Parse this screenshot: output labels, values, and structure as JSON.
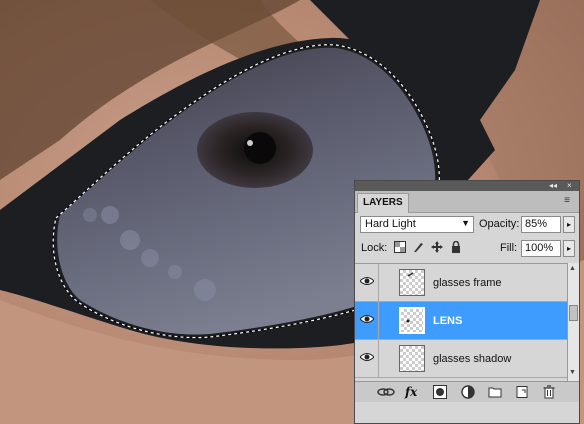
{
  "layers_panel": {
    "tab_title": "LAYERS",
    "panel_controls": {
      "collapse": "◂◂",
      "close": "×"
    },
    "menu_icon": "≡",
    "blend_mode": "Hard Light",
    "opacity_label": "Opacity:",
    "opacity_value": "85%",
    "lock_label": "Lock:",
    "fill_label": "Fill:",
    "fill_value": "100%",
    "layers": [
      {
        "name": "glasses frame",
        "visible": true,
        "selected": false
      },
      {
        "name": "LENS",
        "visible": true,
        "selected": true
      },
      {
        "name": "glasses shadow",
        "visible": true,
        "selected": false
      }
    ],
    "footer_icons": [
      "link-icon",
      "fx-icon",
      "add-mask-icon",
      "adjustment-layer-icon",
      "new-group-icon",
      "new-layer-icon",
      "trash-icon"
    ],
    "fx_label": "fx"
  },
  "colors": {
    "panel_bg": "#d6d6d6",
    "selected_row": "#3e9cff",
    "frame": "#1d1e22",
    "lens": "#5a5d6e",
    "skin": "#b88a70"
  }
}
